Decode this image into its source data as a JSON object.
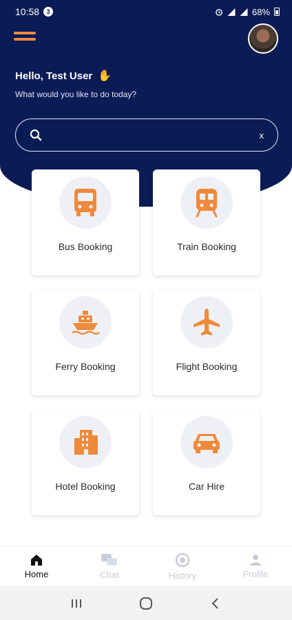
{
  "status_bar": {
    "time": "10:58",
    "badge": "3",
    "battery": "68%"
  },
  "header": {
    "greeting": "Hello, Test User",
    "subtitle": "What would you like to do today?"
  },
  "search": {
    "value": "",
    "placeholder": "",
    "clear_label": "x"
  },
  "services": [
    {
      "label": "Bus Booking",
      "icon": "bus-icon"
    },
    {
      "label": "Train Booking",
      "icon": "train-icon"
    },
    {
      "label": "Ferry Booking",
      "icon": "ferry-icon"
    },
    {
      "label": "Flight Booking",
      "icon": "airplane-icon"
    },
    {
      "label": "Hotel Booking",
      "icon": "hotel-icon"
    },
    {
      "label": "Car Hire",
      "icon": "car-icon"
    }
  ],
  "bottom_nav": [
    {
      "label": "Home",
      "icon": "home-icon",
      "active": true
    },
    {
      "label": "Chat",
      "icon": "chat-icon",
      "active": false
    },
    {
      "label": "History",
      "icon": "history-icon",
      "active": false
    },
    {
      "label": "Profile",
      "icon": "profile-icon",
      "active": false
    }
  ],
  "colors": {
    "header": "#0b1b56",
    "accent": "#ef8a3a",
    "icon_bg": "#eef0f5"
  }
}
